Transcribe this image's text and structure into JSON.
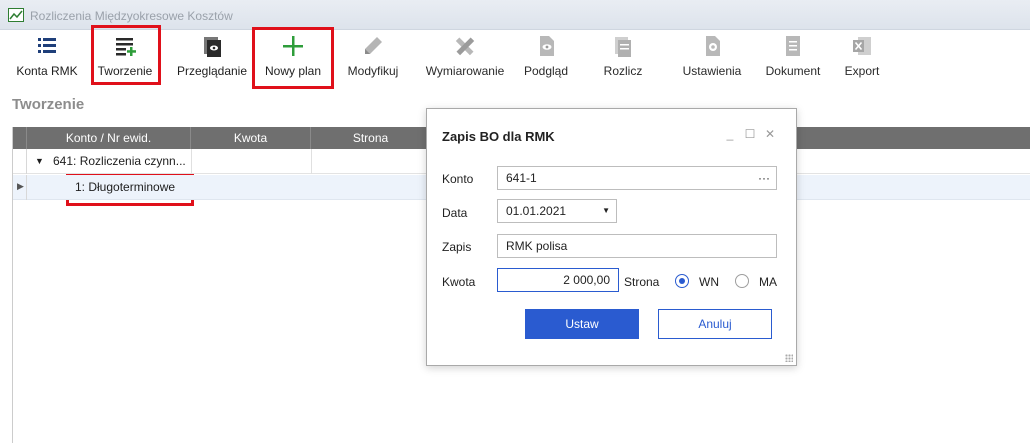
{
  "window": {
    "title": "Rozliczenia Międzyokresowe Kosztów"
  },
  "toolbar": {
    "items": [
      {
        "label": "Konta RMK",
        "icon": "list-icon"
      },
      {
        "label": "Tworzenie",
        "icon": "list-add-icon"
      },
      {
        "label": "Przeglądanie",
        "icon": "view-copy-icon"
      },
      {
        "label": "Nowy plan",
        "icon": "plus-icon"
      },
      {
        "label": "Modyfikuj",
        "icon": "pencil-icon"
      },
      {
        "label": "Wymiarowanie",
        "icon": "ruler-pencil-icon"
      },
      {
        "label": "Podgląd",
        "icon": "eye-document-icon"
      },
      {
        "label": "Rozlicz",
        "icon": "documents-icon"
      },
      {
        "label": "Ustawienia",
        "icon": "settings-document-icon"
      },
      {
        "label": "Dokument",
        "icon": "document-icon"
      },
      {
        "label": "Export",
        "icon": "excel-icon"
      }
    ]
  },
  "section": {
    "title": "Tworzenie"
  },
  "grid": {
    "columns": [
      "Konto / Nr ewid.",
      "Kwota",
      "Strona"
    ],
    "rows": [
      {
        "konto": "641: Rozliczenia czynn...",
        "expanded": true
      },
      {
        "konto": "1: Długoterminowe"
      }
    ]
  },
  "dialog": {
    "title": "Zapis BO dla RMK",
    "fields": {
      "konto": {
        "label": "Konto",
        "value": "641-1",
        "button": "···"
      },
      "data": {
        "label": "Data",
        "value": "01.01.2021"
      },
      "zapis": {
        "label": "Zapis",
        "value": "RMK polisa"
      },
      "kwota": {
        "label": "Kwota",
        "value": "2 000,00"
      },
      "strona": {
        "label": "Strona",
        "options": [
          "WN",
          "MA"
        ],
        "selected": "WN"
      }
    },
    "buttons": {
      "ok": "Ustaw",
      "cancel": "Anuluj"
    }
  },
  "colors": {
    "highlight": "#e0101a",
    "accent": "#2a5bd0",
    "grid_header": "#6f6f6f"
  }
}
